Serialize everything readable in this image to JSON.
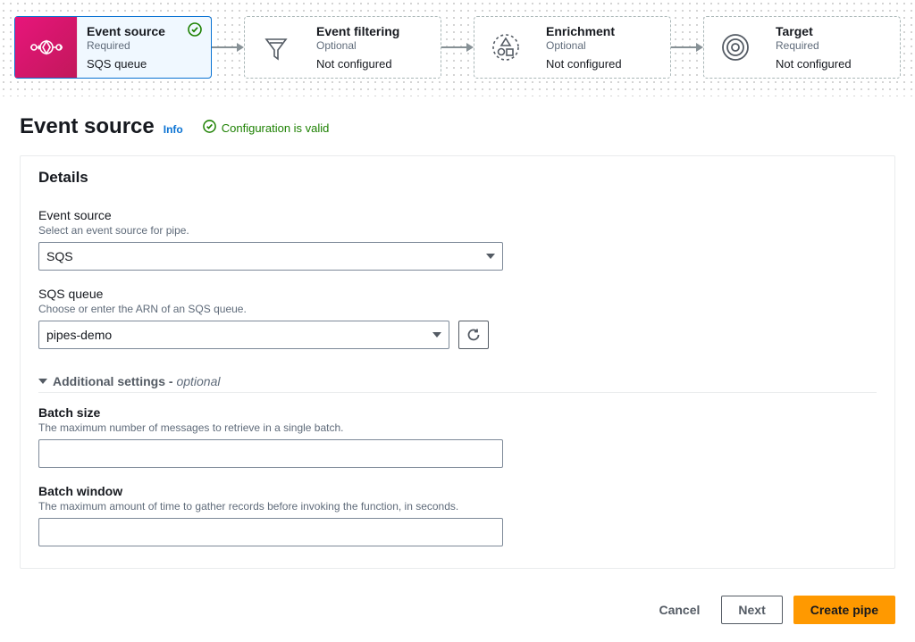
{
  "pipeline": {
    "stages": [
      {
        "title": "Event source",
        "sub": "Required",
        "detail": "SQS queue",
        "active": true,
        "valid": true
      },
      {
        "title": "Event filtering",
        "sub": "Optional",
        "detail": "Not configured",
        "dashed": true
      },
      {
        "title": "Enrichment",
        "sub": "Optional",
        "detail": "Not configured",
        "dashed": true
      },
      {
        "title": "Target",
        "sub": "Required",
        "detail": "Not configured",
        "dashed": true
      }
    ]
  },
  "page": {
    "title": "Event source",
    "info": "Info",
    "valid_text": "Configuration is valid"
  },
  "details": {
    "header": "Details",
    "event_source": {
      "label": "Event source",
      "help": "Select an event source for pipe.",
      "value": "SQS"
    },
    "sqs_queue": {
      "label": "SQS queue",
      "help": "Choose or enter the ARN of an SQS queue.",
      "value": "pipes-demo"
    },
    "additional": {
      "title": "Additional settings -",
      "optional": "optional"
    },
    "batch_size": {
      "label": "Batch size",
      "help": "The maximum number of messages to retrieve in a single batch."
    },
    "batch_window": {
      "label": "Batch window",
      "help": "The maximum amount of time to gather records before invoking the function, in seconds."
    }
  },
  "footer": {
    "cancel": "Cancel",
    "next": "Next",
    "create": "Create pipe"
  }
}
